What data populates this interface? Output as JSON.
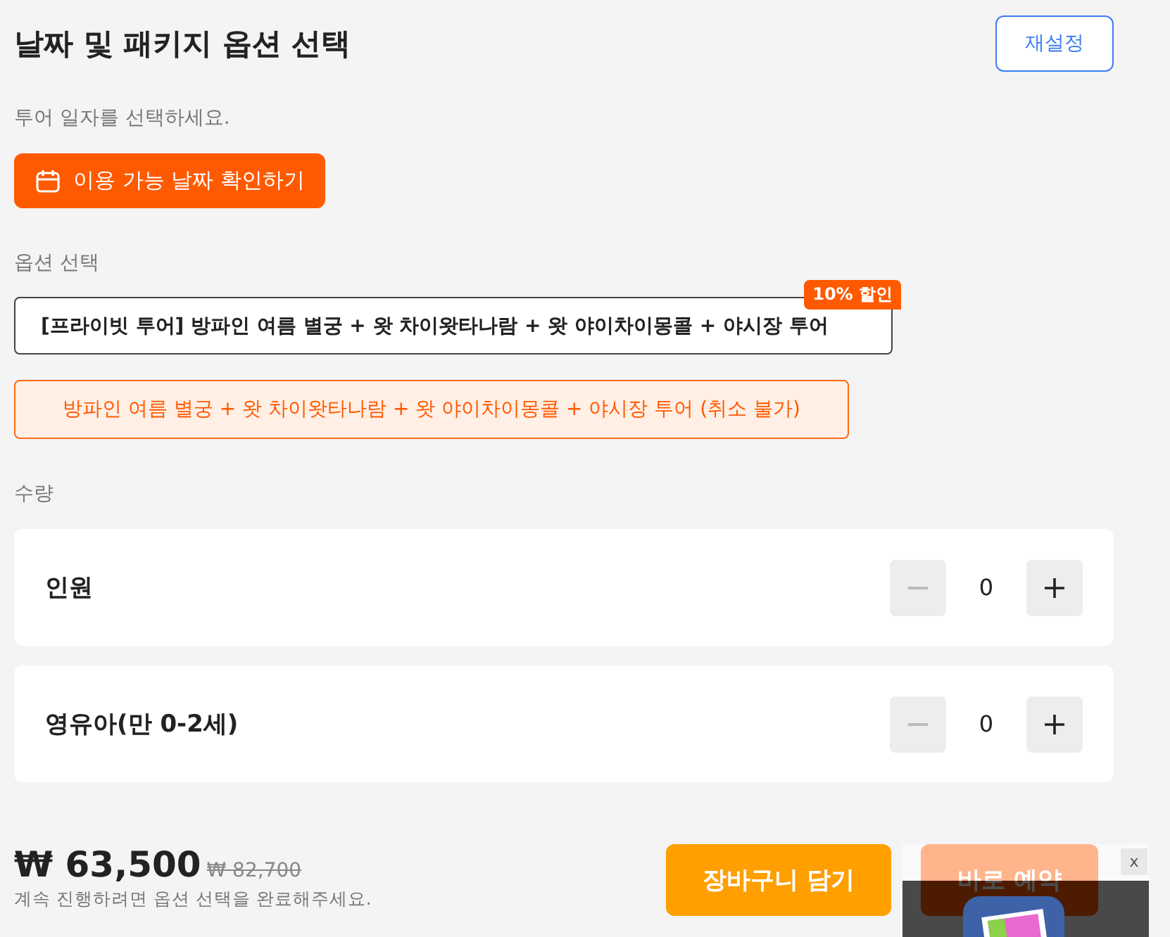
{
  "title": "날짜 및 패키지 옵션 선택",
  "reset_button": "재설정",
  "date_prompt": "투어 일자를 선택하세요.",
  "date_button": "이용 가능 날짜 확인하기",
  "option_label": "옵션 선택",
  "option_select": {
    "value": "[프라이빗 투어] 방파인 여름 별궁 + 왓 차이왓타나람 + 왓 야이차이몽콜 + 야시장 투어",
    "badge": "10% 할인"
  },
  "selected_option": "방파인 여름 별궁 + 왓 차이왓타나람 + 왓 야이차이몽콜 + 야시장 투어 (취소 불가)",
  "quantity_label": "수량",
  "quantity_rows": [
    {
      "label": "인원",
      "value": "0",
      "minus_disabled": true
    },
    {
      "label": "영유아(만 0-2세)",
      "value": "0",
      "minus_disabled": true
    }
  ],
  "price": {
    "current": "₩ 63,500",
    "original": "₩ 82,700"
  },
  "hint": "계속 진행하려면 옵션 선택을 완료해주세요.",
  "buttons": [
    {
      "label": "장바구니 담기",
      "kind": "cart"
    },
    {
      "label": "바로 예약",
      "kind": "book"
    }
  ],
  "popup": {
    "close": "x"
  }
}
